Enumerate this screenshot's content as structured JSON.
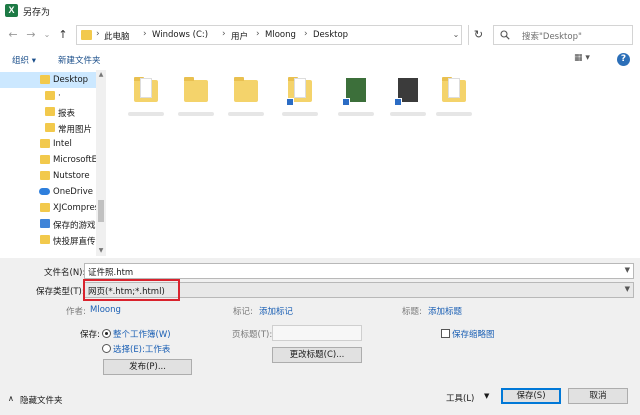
{
  "window": {
    "title": "另存为",
    "app_icon_glyph": "X"
  },
  "nav": {
    "back": "←",
    "forward": "→",
    "history": "⌄",
    "up": "↑",
    "breadcrumb": [
      "此电脑",
      "Windows (C:)",
      "用户",
      "Mloong",
      "Desktop"
    ],
    "separator": "›",
    "dropdown": "⌄",
    "refresh": "↻",
    "search_placeholder": "搜索\"Desktop\""
  },
  "toolbar": {
    "organize": "组织 ▾",
    "new_folder": "新建文件夹",
    "view": "▦ ▾",
    "help": "?"
  },
  "sidebar": {
    "items": [
      {
        "label": "Desktop",
        "icon": "folder-icon"
      },
      {
        "label": "·",
        "icon": "folder-icon"
      },
      {
        "label": "报表",
        "icon": "folder-icon"
      },
      {
        "label": "常用图片",
        "icon": "folder-icon"
      },
      {
        "label": "Intel",
        "icon": "folder-icon"
      },
      {
        "label": "MicrosoftE",
        "icon": "folder-icon"
      },
      {
        "label": "Nutstore",
        "icon": "folder-icon"
      },
      {
        "label": "OneDrive",
        "icon": "cloud-icon"
      },
      {
        "label": "XJCompres",
        "icon": "folder-icon"
      },
      {
        "label": "保存的游戏",
        "icon": "folder-icon"
      },
      {
        "label": "快投屏直传",
        "icon": "folder-icon"
      }
    ]
  },
  "form": {
    "filename_label": "文件名(N):",
    "filename_value": "证件照.htm",
    "type_label": "保存类型(T):",
    "type_value": "网页(*.htm;*.html)",
    "author_label": "作者:",
    "author_value": "Mloong",
    "tags_label": "标记:",
    "tags_link": "添加标记",
    "title_label": "标题:",
    "title_link": "添加标题",
    "save_label": "保存:",
    "radio_workbook": "整个工作簿(W)",
    "radio_selection": "选择(E):工作表",
    "page_title_label": "页标题(T):",
    "change_title_button": "更改标题(C)...",
    "thumbnail_label": "保存缩略图",
    "publish_button": "发布(P)..."
  },
  "footer": {
    "hide_folders": "隐藏文件夹",
    "tools": "工具(L)",
    "save": "保存(S)",
    "cancel": "取消"
  },
  "colors": {
    "highlight_box": "#d9232d",
    "link": "#1a5fb4",
    "selected": "#cce8ff"
  }
}
